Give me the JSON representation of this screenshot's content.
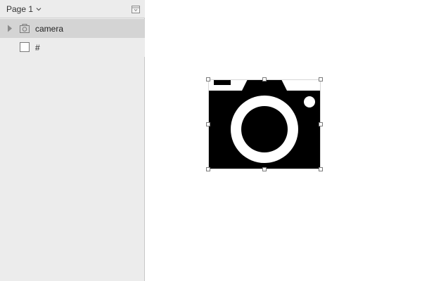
{
  "sidebar": {
    "page_selector": {
      "label": "Page 1",
      "icon": "chevron-down-icon"
    },
    "collapse_icon": "collapse-panel-icon",
    "layers": [
      {
        "label": "camera",
        "icon": "camera-icon",
        "selected": true,
        "expandable": true
      },
      {
        "label": "#",
        "icon": "artboard-icon",
        "selected": false,
        "expandable": false
      }
    ]
  },
  "canvas": {
    "selected_object": "camera",
    "colors": {
      "shape": "#000000",
      "background": "#ffffff",
      "selection_handle_border": "#7a7a7a"
    }
  }
}
